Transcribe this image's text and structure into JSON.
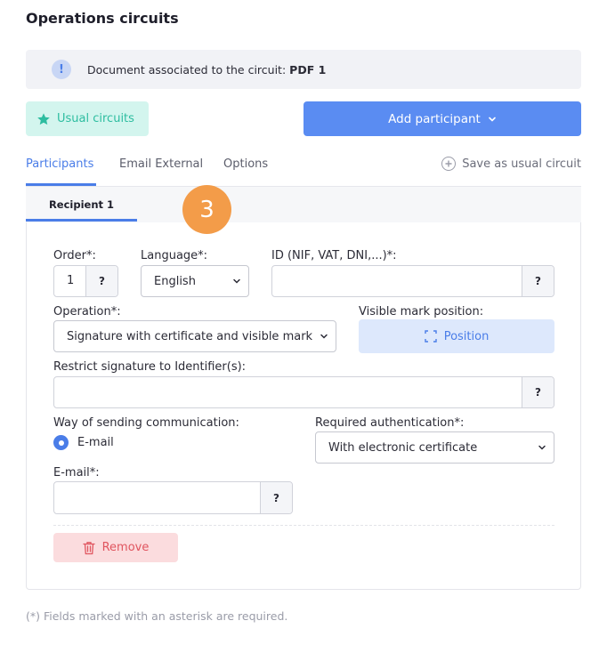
{
  "page": {
    "title": "Operations circuits"
  },
  "info": {
    "text": "Document associated to the circuit:",
    "document_name": "PDF 1",
    "icon": "info-icon"
  },
  "toolbar": {
    "usual_circuits_label": "Usual circuits",
    "add_participant_label": "Add participant"
  },
  "tabs": {
    "items": [
      {
        "label": "Participants",
        "active": true
      },
      {
        "label": "Email External",
        "active": false
      },
      {
        "label": "Options",
        "active": false
      }
    ],
    "save_usual_label": "Save as usual circuit"
  },
  "recipient": {
    "tab_label": "Recipient 1",
    "step_badge": "3"
  },
  "form": {
    "order": {
      "label": "Order*:",
      "value": "1",
      "help": "?"
    },
    "language": {
      "label": "Language*:",
      "value": "English"
    },
    "id": {
      "label": "ID (NIF, VAT, DNI,...)*:",
      "value": "",
      "help": "?"
    },
    "operation": {
      "label": "Operation*:",
      "value": "Signature with certificate and visible mark"
    },
    "visible_mark": {
      "label": "Visible mark position:",
      "button_label": "Position"
    },
    "restrict": {
      "label": "Restrict signature to Identifier(s):",
      "value": "",
      "help": "?"
    },
    "sending": {
      "label": "Way of sending communication:",
      "option": "E-mail",
      "selected": true
    },
    "authentication": {
      "label": "Required authentication*:",
      "value": "With electronic certificate"
    },
    "email": {
      "label": "E-mail*:",
      "value": "",
      "help": "?"
    },
    "remove_label": "Remove"
  },
  "footnote": "(*) Fields marked with an asterisk are required.",
  "colors": {
    "accent": "#4a7de8",
    "primary_button": "#5a8cf2",
    "usual_button_bg": "#d3f5ee",
    "usual_button_text": "#2dbda0",
    "remove_bg": "#fbdcde",
    "remove_text": "#e0555f",
    "badge": "#f39c49"
  }
}
